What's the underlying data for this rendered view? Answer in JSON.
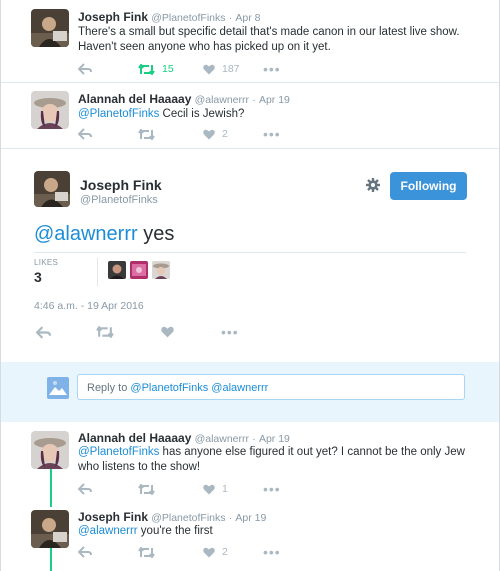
{
  "tweets_above": [
    {
      "name": "Joseph Fink",
      "screen_name": "@PlanetofFinks",
      "date": "Apr 8",
      "text": "There's a small but specific detail that's made canon in our latest live show. Haven't seen anyone who has picked up on it yet.",
      "retweets": "15",
      "likes": "187"
    },
    {
      "name": "Alannah del Haaaay",
      "screen_name": "@alawnerrr",
      "date": "Apr 19",
      "mention": "@PlanetofFinks",
      "text": " Cecil is Jewish?",
      "likes": "2"
    }
  ],
  "main_tweet": {
    "name": "Joseph Fink",
    "screen_name": "@PlanetofFinks",
    "follow_label": "Following",
    "mention": "@alawnerrr",
    "text": " yes",
    "likes_label": "LIKES",
    "likes_count": "3",
    "timestamp": "4:46 a.m. - 19 Apr 2016"
  },
  "reply_box": {
    "prefix": "Reply to ",
    "mentions": "@PlanetofFinks @alawnerrr"
  },
  "replies": [
    {
      "name": "Alannah del Haaaay",
      "screen_name": "@alawnerrr",
      "date": "Apr 19",
      "mention": "@PlanetofFinks",
      "text": " has anyone else figured it out yet? I cannot be the only Jew who listens to the show!",
      "likes": "1"
    },
    {
      "name": "Joseph Fink",
      "screen_name": "@PlanetofFinks",
      "date": "Apr 19",
      "mention": "@alawnerrr",
      "text": " you're the first",
      "likes": "2"
    }
  ],
  "separator": "·",
  "colors": {
    "accent": "#1b8dd6",
    "follow_button": "#3b94d9",
    "retweet": "#19cf86",
    "icon_gray": "#aab8c2"
  },
  "icons": [
    "reply-icon",
    "retweet-icon",
    "heart-icon",
    "more-icon",
    "gear-icon"
  ]
}
